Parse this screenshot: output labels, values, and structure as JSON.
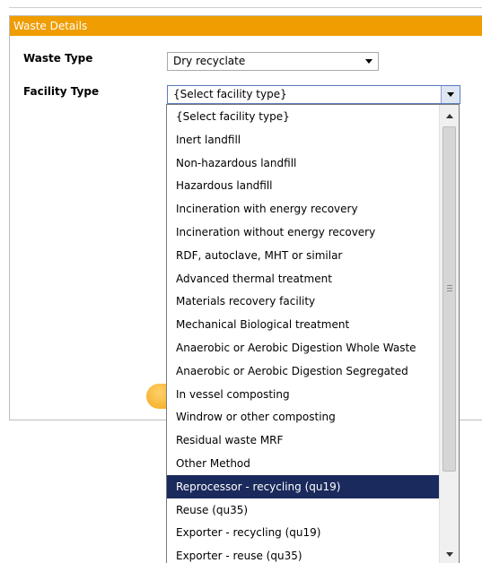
{
  "panel": {
    "title": "Waste Details"
  },
  "fields": {
    "waste_type": {
      "label": "Waste Type",
      "value": "Dry recyclate"
    },
    "facility_type": {
      "label": "Facility Type",
      "value": "{Select facility type}"
    }
  },
  "dropdown": {
    "selected_index": 16,
    "options": [
      "{Select facility type}",
      "Inert landfill",
      "Non-hazardous landfill",
      "Hazardous landfill",
      "Incineration with energy recovery",
      "Incineration without energy recovery",
      "RDF, autoclave, MHT or similar",
      "Advanced thermal treatment",
      "Materials recovery facility",
      "Mechanical Biological treatment",
      "Anaerobic or Aerobic Digestion Whole Waste",
      "Anaerobic or Aerobic Digestion Segregated",
      "In vessel composting",
      "Windrow or other composting",
      "Residual waste MRF",
      "Other Method",
      "Reprocessor - recycling (qu19)",
      "Reuse (qu35)",
      "Exporter - recycling (qu19)",
      "Exporter - reuse (qu35)"
    ]
  },
  "colors": {
    "header_bg": "#ef9d00",
    "selected_bg": "#1b2a5c"
  },
  "icons": {
    "select_arrow": "chevron-down-icon",
    "scroll_up": "scroll-up-icon",
    "scroll_down": "scroll-down-icon"
  }
}
